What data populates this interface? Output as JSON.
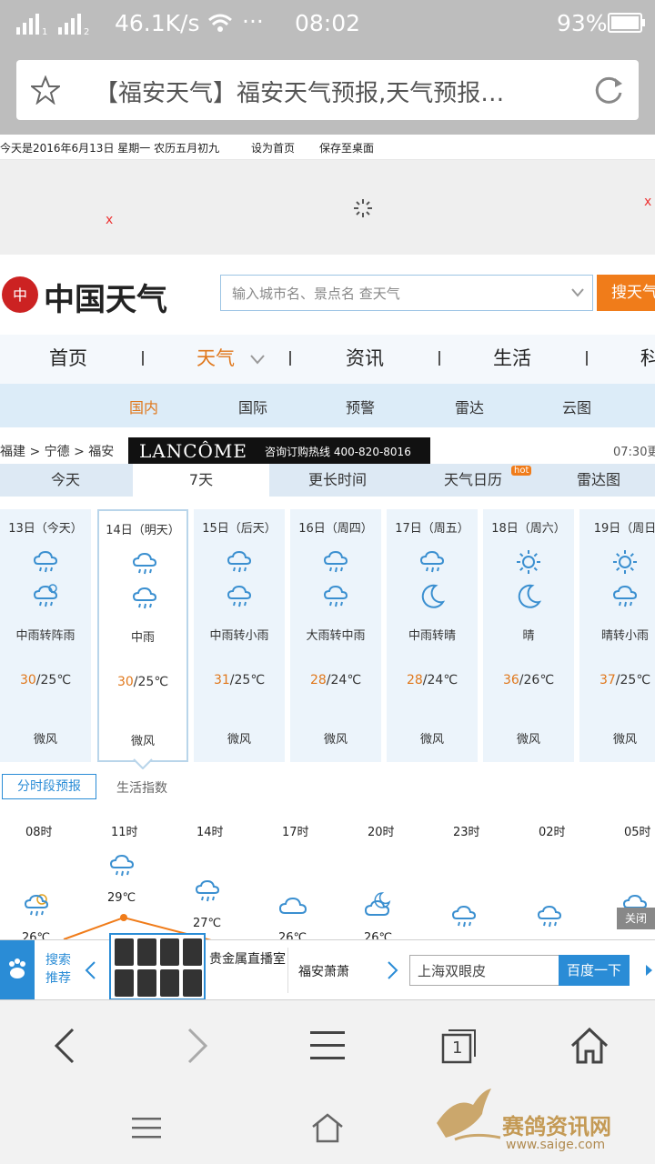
{
  "status": {
    "signal": "46.1K/s",
    "dots": "···",
    "time": "08:02",
    "battery": "93%"
  },
  "browser": {
    "title": "【福安天气】福安天气预报,天气预报…"
  },
  "topline": {
    "date": "今天是2016年6月13日 星期一 农历五月初九",
    "home": "设为首页",
    "save": "保存至桌面"
  },
  "ad": {
    "close_left": "x",
    "close_right": "x"
  },
  "header": {
    "logo_text": "中国天气",
    "search_placeholder": "输入城市名、景点名 查天气",
    "search_button": "搜天气"
  },
  "nav": {
    "items": [
      "首页",
      "天气",
      "资讯",
      "生活",
      "科"
    ]
  },
  "subnav": {
    "items": [
      "国内",
      "国际",
      "预警",
      "雷达",
      "云图"
    ]
  },
  "crumb": {
    "path": "福建 > 宁德 > 福安",
    "ad_brand": "LANCÔME",
    "ad_text": "咨询订购热线 400-820-8016",
    "update": "07:30更"
  },
  "tabs": {
    "items": [
      "今天",
      "7天",
      "更长时间",
      "天气日历",
      "雷达图"
    ],
    "hot": "hot"
  },
  "days": [
    {
      "date": "13日（今天）",
      "desc": "中雨转阵雨",
      "hi": "30",
      "lo": "/25℃",
      "wind": "微风",
      "top": "rain",
      "bot": "shower"
    },
    {
      "date": "14日（明天）",
      "desc": "中雨",
      "hi": "30",
      "lo": "/25℃",
      "wind": "微风",
      "top": "rain",
      "bot": "rain"
    },
    {
      "date": "15日（后天）",
      "desc": "中雨转小雨",
      "hi": "31",
      "lo": "/25℃",
      "wind": "微风",
      "top": "rain",
      "bot": "rain"
    },
    {
      "date": "16日（周四）",
      "desc": "大雨转中雨",
      "hi": "28",
      "lo": "/24℃",
      "wind": "微风",
      "top": "rain",
      "bot": "rain"
    },
    {
      "date": "17日（周五）",
      "desc": "中雨转晴",
      "hi": "28",
      "lo": "/24℃",
      "wind": "微风",
      "top": "rain",
      "bot": "moon"
    },
    {
      "date": "18日（周六）",
      "desc": "晴",
      "hi": "36",
      "lo": "/26℃",
      "wind": "微风",
      "top": "sun",
      "bot": "moon"
    },
    {
      "date": "19日（周日",
      "desc": "晴转小雨",
      "hi": "37",
      "lo": "/25℃",
      "wind": "微风",
      "top": "sun",
      "bot": "rain"
    }
  ],
  "subtabs": {
    "hourly": "分时段预报",
    "life": "生活指数"
  },
  "hours": [
    {
      "time": "08时",
      "icon": "sun-cloud",
      "temp": "26℃"
    },
    {
      "time": "11时",
      "icon": "rain",
      "temp": "29℃"
    },
    {
      "time": "14时",
      "icon": "rain",
      "temp": "27℃"
    },
    {
      "time": "17时",
      "icon": "cloud",
      "temp": "26℃"
    },
    {
      "time": "20时",
      "icon": "moon-cloud",
      "temp": "26℃"
    },
    {
      "time": "23时",
      "icon": "rain",
      "temp": ""
    },
    {
      "time": "02时",
      "icon": "rain",
      "temp": ""
    },
    {
      "time": "05时",
      "icon": "rain",
      "temp": ""
    }
  ],
  "close_popup": "关闭",
  "baidu": {
    "label": "搜索推荐",
    "item1": "贵金属直播室",
    "item2": "福安萧萧",
    "input": "上海双眼皮",
    "button": "百度一下"
  },
  "watermark": {
    "name": "赛鸽资讯网",
    "url": "www.saige.com"
  },
  "browser_nav": {
    "tabs_count": "1"
  },
  "colors": {
    "accent": "#e0781c",
    "blue": "#2a8cd6",
    "icon": "#3a8fd0"
  }
}
